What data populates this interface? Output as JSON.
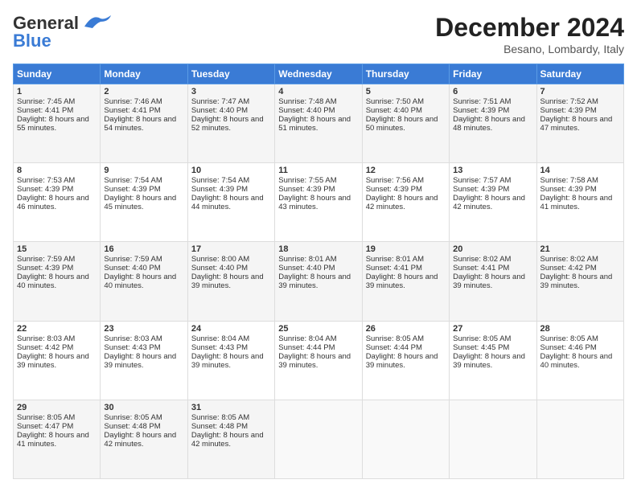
{
  "header": {
    "logo_general": "General",
    "logo_blue": "Blue",
    "month_title": "December 2024",
    "location": "Besano, Lombardy, Italy"
  },
  "days_of_week": [
    "Sunday",
    "Monday",
    "Tuesday",
    "Wednesday",
    "Thursday",
    "Friday",
    "Saturday"
  ],
  "weeks": [
    [
      {
        "day": 1,
        "sunrise": "Sunrise: 7:45 AM",
        "sunset": "Sunset: 4:41 PM",
        "daylight": "Daylight: 8 hours and 55 minutes."
      },
      {
        "day": 2,
        "sunrise": "Sunrise: 7:46 AM",
        "sunset": "Sunset: 4:41 PM",
        "daylight": "Daylight: 8 hours and 54 minutes."
      },
      {
        "day": 3,
        "sunrise": "Sunrise: 7:47 AM",
        "sunset": "Sunset: 4:40 PM",
        "daylight": "Daylight: 8 hours and 52 minutes."
      },
      {
        "day": 4,
        "sunrise": "Sunrise: 7:48 AM",
        "sunset": "Sunset: 4:40 PM",
        "daylight": "Daylight: 8 hours and 51 minutes."
      },
      {
        "day": 5,
        "sunrise": "Sunrise: 7:50 AM",
        "sunset": "Sunset: 4:40 PM",
        "daylight": "Daylight: 8 hours and 50 minutes."
      },
      {
        "day": 6,
        "sunrise": "Sunrise: 7:51 AM",
        "sunset": "Sunset: 4:39 PM",
        "daylight": "Daylight: 8 hours and 48 minutes."
      },
      {
        "day": 7,
        "sunrise": "Sunrise: 7:52 AM",
        "sunset": "Sunset: 4:39 PM",
        "daylight": "Daylight: 8 hours and 47 minutes."
      }
    ],
    [
      {
        "day": 8,
        "sunrise": "Sunrise: 7:53 AM",
        "sunset": "Sunset: 4:39 PM",
        "daylight": "Daylight: 8 hours and 46 minutes."
      },
      {
        "day": 9,
        "sunrise": "Sunrise: 7:54 AM",
        "sunset": "Sunset: 4:39 PM",
        "daylight": "Daylight: 8 hours and 45 minutes."
      },
      {
        "day": 10,
        "sunrise": "Sunrise: 7:54 AM",
        "sunset": "Sunset: 4:39 PM",
        "daylight": "Daylight: 8 hours and 44 minutes."
      },
      {
        "day": 11,
        "sunrise": "Sunrise: 7:55 AM",
        "sunset": "Sunset: 4:39 PM",
        "daylight": "Daylight: 8 hours and 43 minutes."
      },
      {
        "day": 12,
        "sunrise": "Sunrise: 7:56 AM",
        "sunset": "Sunset: 4:39 PM",
        "daylight": "Daylight: 8 hours and 42 minutes."
      },
      {
        "day": 13,
        "sunrise": "Sunrise: 7:57 AM",
        "sunset": "Sunset: 4:39 PM",
        "daylight": "Daylight: 8 hours and 42 minutes."
      },
      {
        "day": 14,
        "sunrise": "Sunrise: 7:58 AM",
        "sunset": "Sunset: 4:39 PM",
        "daylight": "Daylight: 8 hours and 41 minutes."
      }
    ],
    [
      {
        "day": 15,
        "sunrise": "Sunrise: 7:59 AM",
        "sunset": "Sunset: 4:39 PM",
        "daylight": "Daylight: 8 hours and 40 minutes."
      },
      {
        "day": 16,
        "sunrise": "Sunrise: 7:59 AM",
        "sunset": "Sunset: 4:40 PM",
        "daylight": "Daylight: 8 hours and 40 minutes."
      },
      {
        "day": 17,
        "sunrise": "Sunrise: 8:00 AM",
        "sunset": "Sunset: 4:40 PM",
        "daylight": "Daylight: 8 hours and 39 minutes."
      },
      {
        "day": 18,
        "sunrise": "Sunrise: 8:01 AM",
        "sunset": "Sunset: 4:40 PM",
        "daylight": "Daylight: 8 hours and 39 minutes."
      },
      {
        "day": 19,
        "sunrise": "Sunrise: 8:01 AM",
        "sunset": "Sunset: 4:41 PM",
        "daylight": "Daylight: 8 hours and 39 minutes."
      },
      {
        "day": 20,
        "sunrise": "Sunrise: 8:02 AM",
        "sunset": "Sunset: 4:41 PM",
        "daylight": "Daylight: 8 hours and 39 minutes."
      },
      {
        "day": 21,
        "sunrise": "Sunrise: 8:02 AM",
        "sunset": "Sunset: 4:42 PM",
        "daylight": "Daylight: 8 hours and 39 minutes."
      }
    ],
    [
      {
        "day": 22,
        "sunrise": "Sunrise: 8:03 AM",
        "sunset": "Sunset: 4:42 PM",
        "daylight": "Daylight: 8 hours and 39 minutes."
      },
      {
        "day": 23,
        "sunrise": "Sunrise: 8:03 AM",
        "sunset": "Sunset: 4:43 PM",
        "daylight": "Daylight: 8 hours and 39 minutes."
      },
      {
        "day": 24,
        "sunrise": "Sunrise: 8:04 AM",
        "sunset": "Sunset: 4:43 PM",
        "daylight": "Daylight: 8 hours and 39 minutes."
      },
      {
        "day": 25,
        "sunrise": "Sunrise: 8:04 AM",
        "sunset": "Sunset: 4:44 PM",
        "daylight": "Daylight: 8 hours and 39 minutes."
      },
      {
        "day": 26,
        "sunrise": "Sunrise: 8:05 AM",
        "sunset": "Sunset: 4:44 PM",
        "daylight": "Daylight: 8 hours and 39 minutes."
      },
      {
        "day": 27,
        "sunrise": "Sunrise: 8:05 AM",
        "sunset": "Sunset: 4:45 PM",
        "daylight": "Daylight: 8 hours and 39 minutes."
      },
      {
        "day": 28,
        "sunrise": "Sunrise: 8:05 AM",
        "sunset": "Sunset: 4:46 PM",
        "daylight": "Daylight: 8 hours and 40 minutes."
      }
    ],
    [
      {
        "day": 29,
        "sunrise": "Sunrise: 8:05 AM",
        "sunset": "Sunset: 4:47 PM",
        "daylight": "Daylight: 8 hours and 41 minutes."
      },
      {
        "day": 30,
        "sunrise": "Sunrise: 8:05 AM",
        "sunset": "Sunset: 4:48 PM",
        "daylight": "Daylight: 8 hours and 42 minutes."
      },
      {
        "day": 31,
        "sunrise": "Sunrise: 8:05 AM",
        "sunset": "Sunset: 4:48 PM",
        "daylight": "Daylight: 8 hours and 42 minutes."
      },
      null,
      null,
      null,
      null
    ]
  ]
}
